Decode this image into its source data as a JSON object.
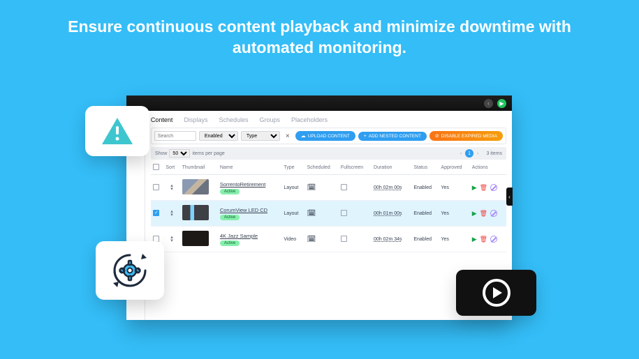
{
  "headline": "Ensure continuous content playback and minimize downtime with automated monitoring.",
  "tabs": [
    "Content",
    "Displays",
    "Schedules",
    "Groups",
    "Placeholders"
  ],
  "filters": {
    "search_placeholder": "Search",
    "enabled": "Enabled",
    "type": "Type",
    "close": "×"
  },
  "buttons": {
    "upload": "UPLOAD CONTENT",
    "add_nested": "ADD NESTED CONTENT",
    "disable_expired": "DISABLE EXPIRED MEDIA"
  },
  "pager": {
    "show": "Show",
    "per_page_value": "50",
    "items_per_page": "items per page",
    "total": "3 items",
    "page": "1"
  },
  "columns": [
    "",
    "Sort",
    "Thumbnail",
    "Name",
    "Type",
    "Scheduled",
    "Fullscreen",
    "Duration",
    "Status",
    "Approved",
    "Actions"
  ],
  "status_badge": "Active",
  "rows": [
    {
      "name": "SorrentoRetirement",
      "type": "Layout",
      "duration": "00h 02m 00s",
      "status": "Enabled",
      "approved": "Yes",
      "selected": false
    },
    {
      "name": "CorumView LED CD",
      "type": "Layout",
      "duration": "00h 01m 00s",
      "status": "Enabled",
      "approved": "Yes",
      "selected": true
    },
    {
      "name": "4K Jazz Sample",
      "type": "Video",
      "duration": "00h 02m 34s",
      "status": "Enabled",
      "approved": "Yes",
      "selected": false
    }
  ]
}
